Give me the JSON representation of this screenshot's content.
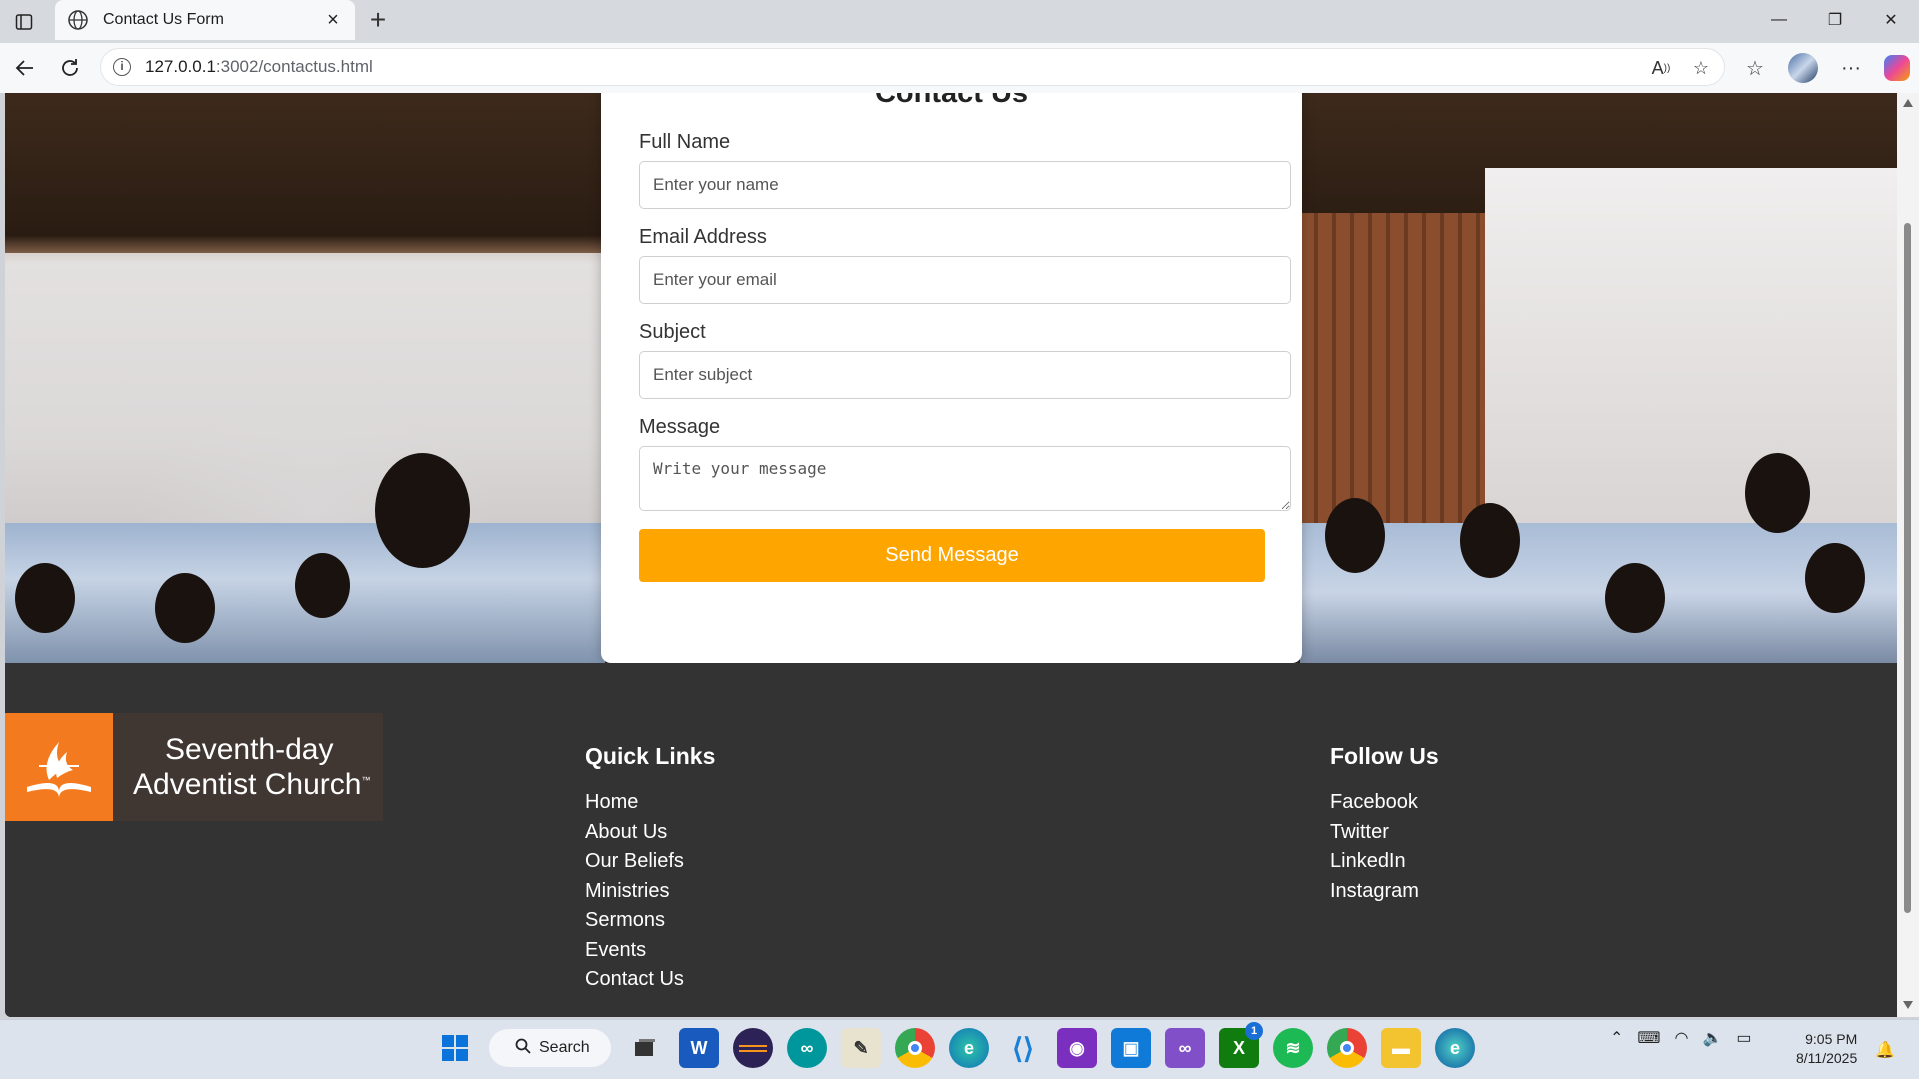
{
  "browser": {
    "tab_title": "Contact Us Form",
    "url_host": "127.0.0.1",
    "url_path": ":3002/contactus.html"
  },
  "form": {
    "heading": "Contact Us",
    "name_label": "Full Name",
    "name_placeholder": "Enter your name",
    "email_label": "Email Address",
    "email_placeholder": "Enter your email",
    "subject_label": "Subject",
    "subject_placeholder": "Enter subject",
    "message_label": "Message",
    "message_placeholder": "Write your message",
    "submit_label": "Send Message"
  },
  "footer": {
    "logo": {
      "line1": "Seventh-day",
      "line2": "Adventist Church",
      "trademark": "™"
    },
    "quick_links_title": "Quick Links",
    "quick_links": [
      "Home",
      "About Us",
      "Our Beliefs",
      "Ministries",
      "Sermons",
      "Events",
      "Contact Us"
    ],
    "follow_title": "Follow Us",
    "follow_links": [
      "Facebook",
      "Twitter",
      "LinkedIn",
      "Instagram"
    ]
  },
  "colors": {
    "accent": "#ffa500",
    "footer_bg": "#333333",
    "logo_orange": "#f47a20"
  },
  "taskbar": {
    "search_label": "Search",
    "badge_count": "1",
    "time": "9:05 PM",
    "date": "8/11/2025"
  }
}
